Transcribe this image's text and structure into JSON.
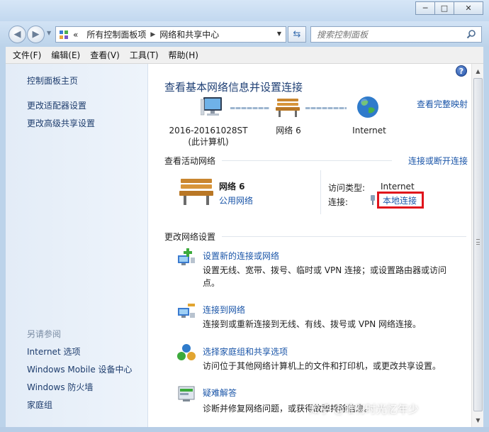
{
  "window": {
    "minimize_glyph": "─",
    "maximize_glyph": "□",
    "close_glyph": "✕"
  },
  "address": {
    "overflow": "«",
    "crumbs": [
      "所有控制面板项",
      "网络和共享中心"
    ],
    "search_placeholder": "搜索控制面板"
  },
  "menu": [
    "文件(F)",
    "编辑(E)",
    "查看(V)",
    "工具(T)",
    "帮助(H)"
  ],
  "sidebar": {
    "top_links": [
      "控制面板主页",
      "更改适配器设置",
      "更改高级共享设置"
    ],
    "see_also_heading": "另请参阅",
    "see_also_links": [
      "Internet 选项",
      "Windows Mobile 设备中心",
      "Windows 防火墙",
      "家庭组"
    ]
  },
  "main": {
    "title": "查看基本网络信息并设置连接",
    "full_map_link": "查看完整映射",
    "map": {
      "computer_line1": "2016-20161028ST",
      "computer_line2": "(此计算机)",
      "network": "网络  6",
      "internet": "Internet"
    },
    "active_section": {
      "title": "查看活动网络",
      "toggle_link": "连接或断开连接",
      "network_name": "网络  6",
      "network_type": "公用网络",
      "access_type_label": "访问类型:",
      "access_type_value": "Internet",
      "connection_label": "连接:",
      "connection_value": "本地连接"
    },
    "change_section": {
      "title": "更改网络设置",
      "tasks": [
        {
          "link": "设置新的连接或网络",
          "desc": "设置无线、宽带、拨号、临时或 VPN 连接；或设置路由器或访问点。"
        },
        {
          "link": "连接到网络",
          "desc": "连接到或重新连接到无线、有线、拨号或 VPN 网络连接。"
        },
        {
          "link": "选择家庭组和共享选项",
          "desc": "访问位于其他网络计算机上的文件和打印机，或更改共享设置。"
        },
        {
          "link": "疑难解答",
          "desc": "诊断并修复网络问题，或获得故障排除信息。"
        }
      ]
    }
  },
  "help_glyph": "?",
  "watermark": "知乎 @唯有时光忆年少",
  "colors": {
    "link": "#1a55a8",
    "title": "#1e3f74",
    "highlight_box": "#e0141c",
    "sidebar_bg": "#e3ecf7"
  }
}
